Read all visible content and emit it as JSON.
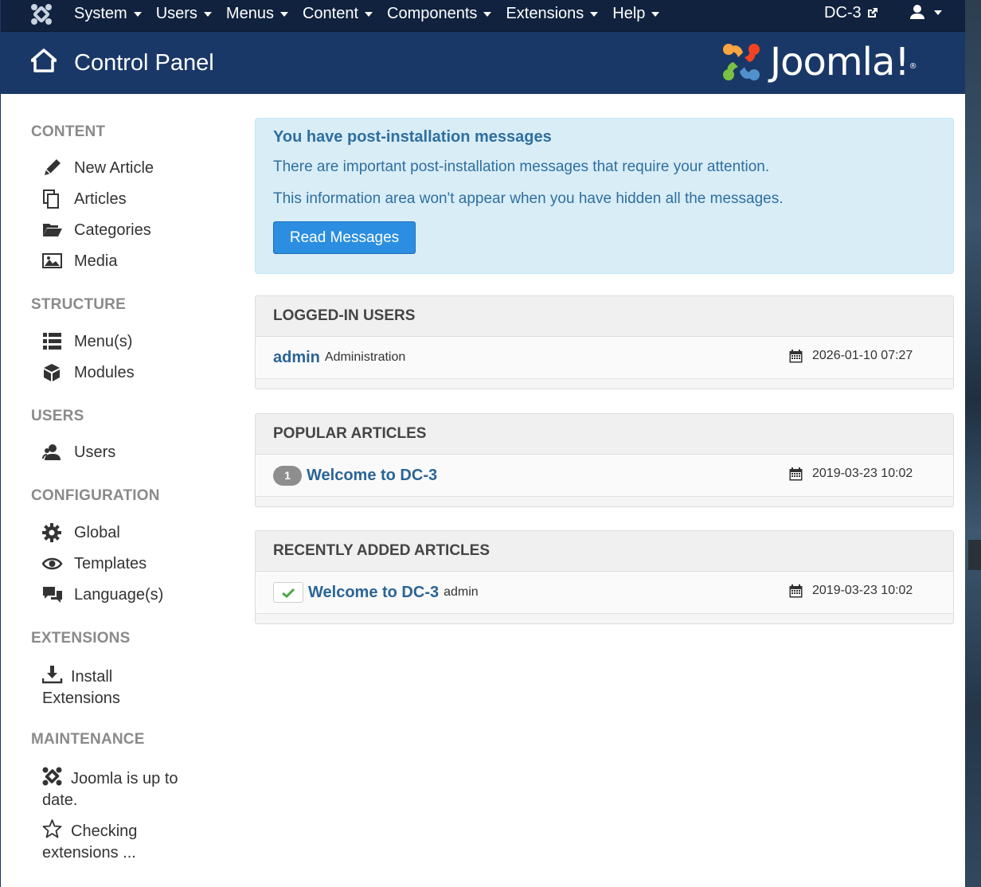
{
  "topnav": {
    "menu": [
      "System",
      "Users",
      "Menus",
      "Content",
      "Components",
      "Extensions",
      "Help"
    ],
    "site_name": "DC-3"
  },
  "header": {
    "title": "Control Panel",
    "logo_text": "Joomla!"
  },
  "sidebar": {
    "sections": [
      {
        "heading": "CONTENT",
        "items": [
          "New Article",
          "Articles",
          "Categories",
          "Media"
        ]
      },
      {
        "heading": "STRUCTURE",
        "items": [
          "Menu(s)",
          "Modules"
        ]
      },
      {
        "heading": "USERS",
        "items": [
          "Users"
        ]
      },
      {
        "heading": "CONFIGURATION",
        "items": [
          "Global",
          "Templates",
          "Language(s)"
        ]
      },
      {
        "heading": "EXTENSIONS",
        "items": [
          "Install Extensions"
        ]
      },
      {
        "heading": "MAINTENANCE",
        "items": [
          "Joomla is up to date.",
          "Checking extensions ..."
        ]
      }
    ]
  },
  "alert": {
    "title": "You have post-installation messages",
    "line1": "There are important post-installation messages that require your attention.",
    "line2": "This information area won't appear when you have hidden all the messages.",
    "button": "Read Messages"
  },
  "panels": {
    "logged_in": {
      "heading": "LOGGED-IN USERS",
      "user": "admin",
      "role": "Administration",
      "date": "2026-01-10 07:27"
    },
    "popular": {
      "heading": "POPULAR ARTICLES",
      "hits": "1",
      "title": "Welcome to DC-3",
      "date": "2019-03-23 10:02"
    },
    "recent": {
      "heading": "RECENTLY ADDED ARTICLES",
      "title": "Welcome to DC-3",
      "author": "admin",
      "date": "2019-03-23 10:02"
    }
  },
  "colors": {
    "topnav_bg": "#10223e",
    "header_bg": "#1a3867",
    "alert_bg": "#d9edf7",
    "alert_text": "#2f6f9f",
    "primary_button": "#2b8ee0",
    "link": "#2a6496",
    "sidebar_heading": "#8a8a8a"
  }
}
